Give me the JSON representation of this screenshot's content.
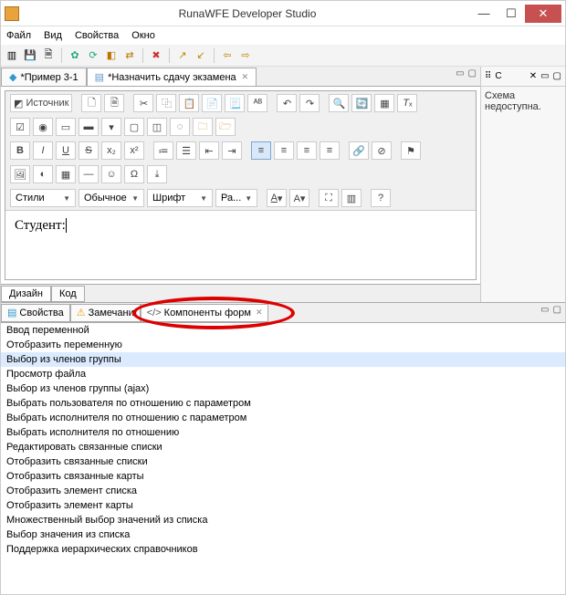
{
  "window": {
    "title": "RunaWFE Developer Studio"
  },
  "menu": {
    "file": "Файл",
    "view": "Вид",
    "properties": "Свойства",
    "window": "Окно"
  },
  "editor_tabs": {
    "t1": "*Пример 3-1",
    "t2": "*Назначить сдачу экзамена"
  },
  "ck": {
    "source": "Источник",
    "styles": "Стили",
    "format": "Обычное",
    "font": "Шрифт",
    "size": "Ра...",
    "content": "Студент:"
  },
  "bottom_tabs": {
    "design": "Дизайн",
    "code": "Код"
  },
  "outline": {
    "label": "C",
    "body": "Схема недоступна."
  },
  "lower_tabs": {
    "props": "Свойства",
    "notes": "Замечани",
    "components": "Компоненты форм"
  },
  "components": [
    "Ввод переменной",
    "Отобразить переменную",
    "Выбор из членов группы",
    "Просмотр файла",
    "Выбор из членов группы (ajax)",
    "Выбрать пользователя по отношению с параметром",
    "Выбрать исполнителя по отношению с параметром",
    "Выбрать исполнителя по отношению",
    "Редактировать связанные списки",
    "Отобразить связанные списки",
    "Отобразить связанные карты",
    "Отобразить элемент списка",
    "Отобразить элемент карты",
    "Множественный выбор значений из списка",
    "Выбор значения из списка",
    "Поддержка иерархических справочников"
  ],
  "selected_component_index": 2
}
